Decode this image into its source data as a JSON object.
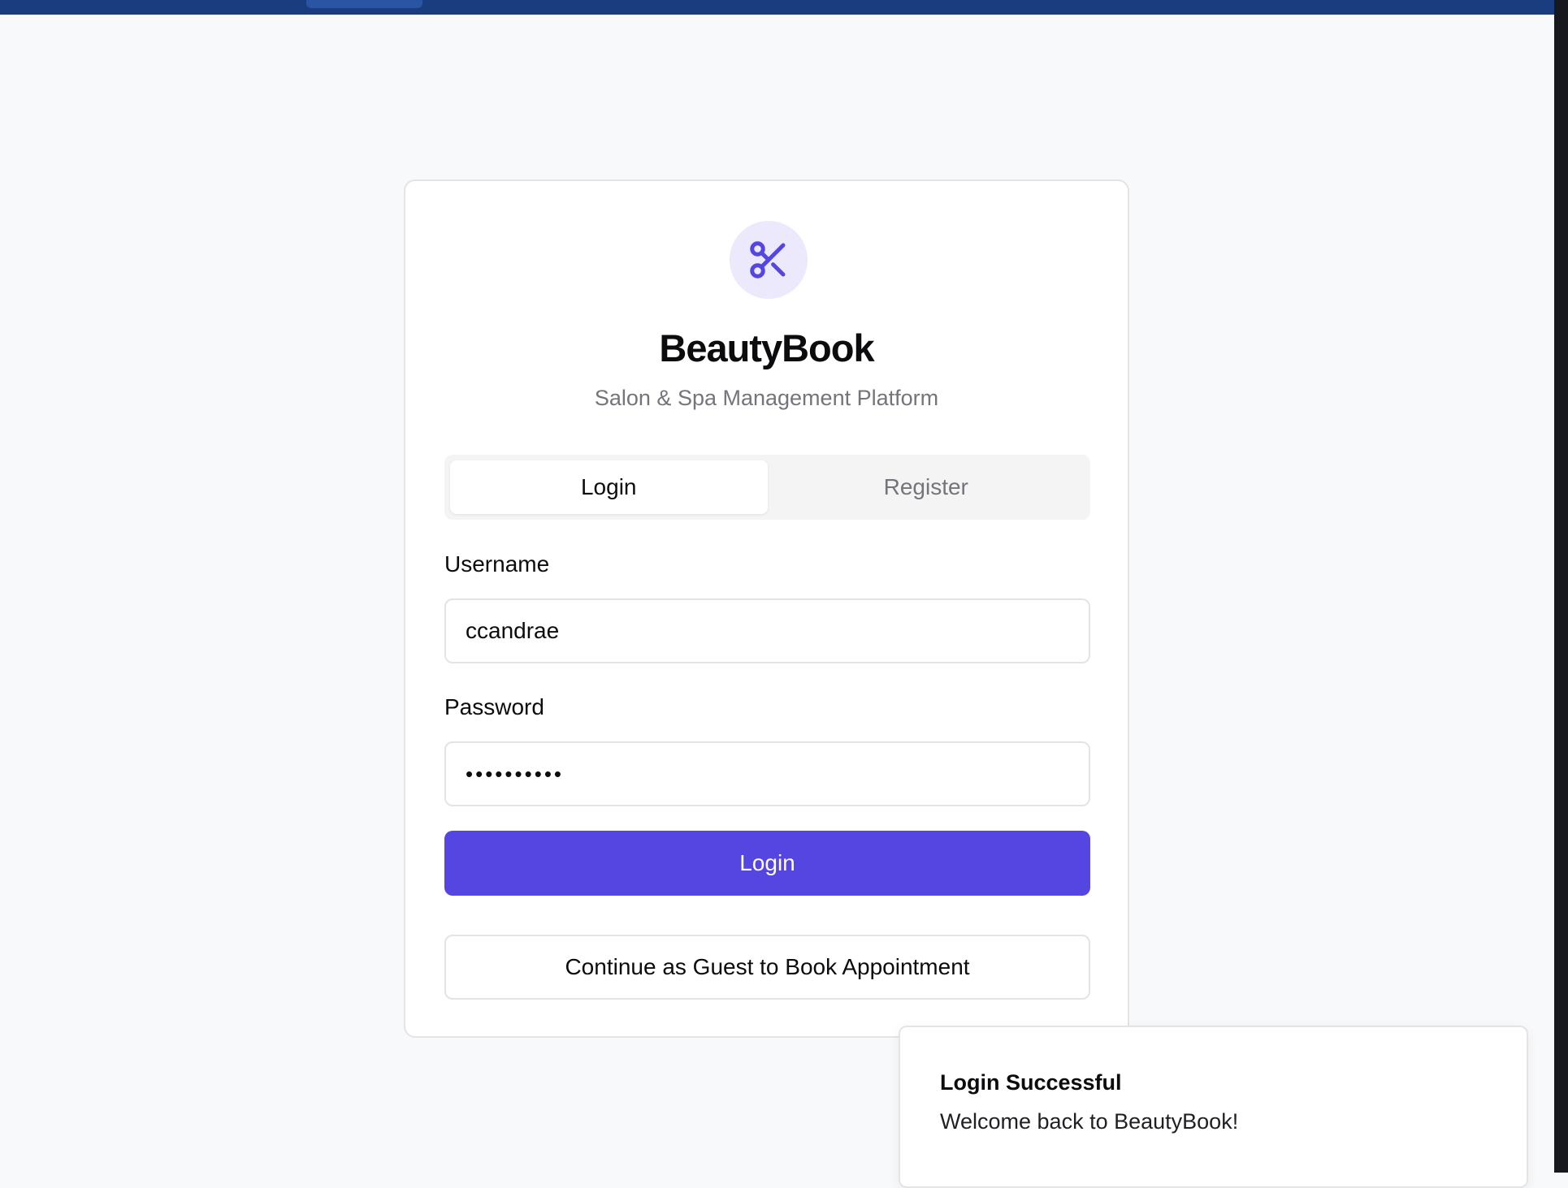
{
  "brand": {
    "name": "BeautyBook",
    "tagline": "Salon & Spa Management Platform",
    "logo_icon": "scissors-icon",
    "accent_color": "#5546e2"
  },
  "tabs": [
    {
      "label": "Login",
      "active": true
    },
    {
      "label": "Register",
      "active": false
    }
  ],
  "form": {
    "username_label": "Username",
    "username_value": "ccandrae",
    "password_label": "Password",
    "password_value": "••••••••••",
    "submit_label": "Login",
    "guest_label": "Continue as Guest to Book Appointment"
  },
  "toast": {
    "title": "Login Successful",
    "description": "Welcome back to BeautyBook!"
  }
}
